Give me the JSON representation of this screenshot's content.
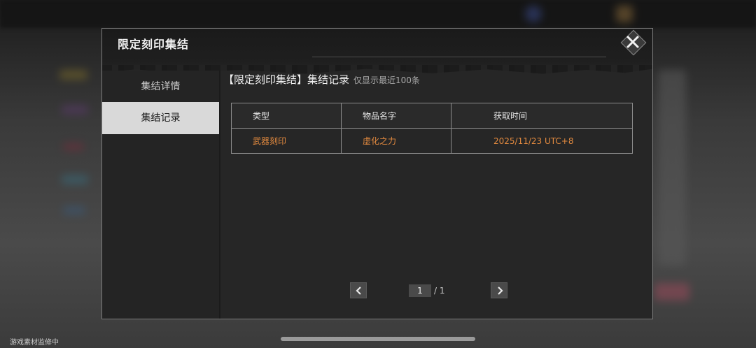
{
  "dialog": {
    "title": "限定刻印集结"
  },
  "sidebar": {
    "items": [
      {
        "label": "集结详情",
        "active": false
      },
      {
        "label": "集结记录",
        "active": true
      }
    ]
  },
  "content": {
    "title": "【限定刻印集结】集结记录",
    "subtitle": "仅显示最近100条",
    "table": {
      "headers": [
        "类型",
        "物品名字",
        "获取时间"
      ],
      "rows": [
        [
          "武器刻印",
          "虚化之力",
          "2025/11/23 UTC+8"
        ]
      ]
    }
  },
  "pager": {
    "current": "1",
    "total": "/ 1"
  },
  "watermark": "游戏素材监修中",
  "colors": {
    "accent": "#e38a3f",
    "active_tab": "#d9d9d9"
  },
  "icons": {
    "close": "close-icon",
    "prev": "chevron-left-icon",
    "next": "chevron-right-icon"
  }
}
